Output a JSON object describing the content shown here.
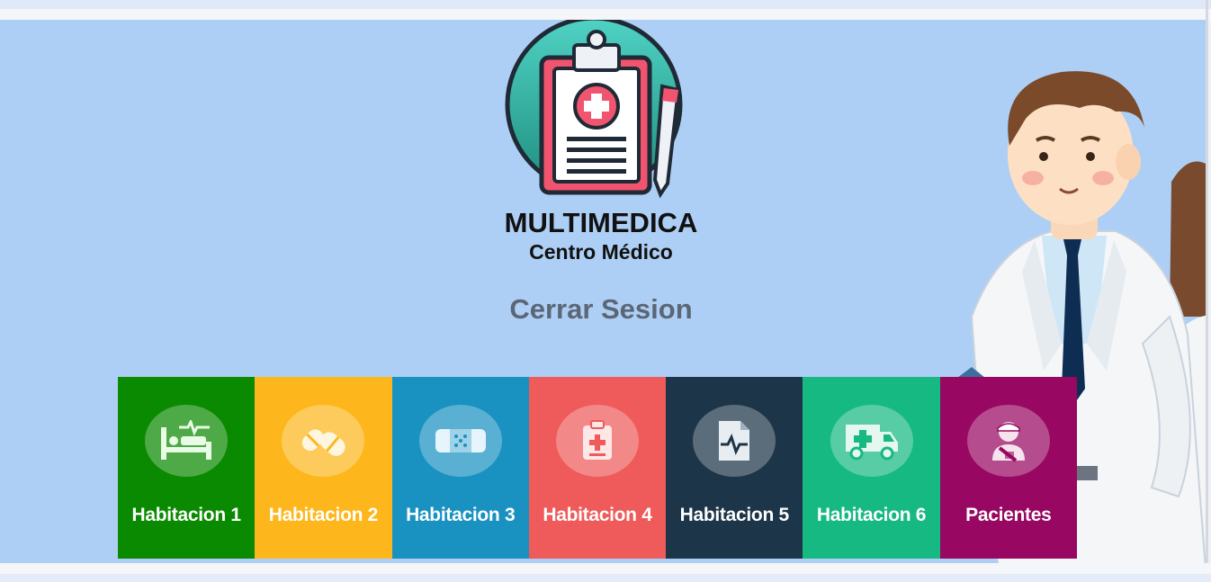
{
  "brand": {
    "title": "MULTIMEDICA",
    "subtitle": "Centro Médico"
  },
  "session": {
    "logout_label": "Cerrar Sesion"
  },
  "tiles": [
    {
      "label": "Habitacion 1",
      "icon": "hospital-bed-icon",
      "color": "#0a8a00"
    },
    {
      "label": "Habitacion 2",
      "icon": "pills-icon",
      "color": "#fdb71c"
    },
    {
      "label": "Habitacion 3",
      "icon": "bandage-icon",
      "color": "#1a92c1"
    },
    {
      "label": "Habitacion 4",
      "icon": "clipboard-plus-icon",
      "color": "#ef5a5a"
    },
    {
      "label": "Habitacion 5",
      "icon": "medical-file-icon",
      "color": "#1c3548"
    },
    {
      "label": "Habitacion 6",
      "icon": "ambulance-icon",
      "color": "#17b983"
    },
    {
      "label": "Pacientes",
      "icon": "injured-patient-icon",
      "color": "#980761"
    }
  ],
  "colors": {
    "background": "#aecff5",
    "logout_text": "#5b6676"
  }
}
